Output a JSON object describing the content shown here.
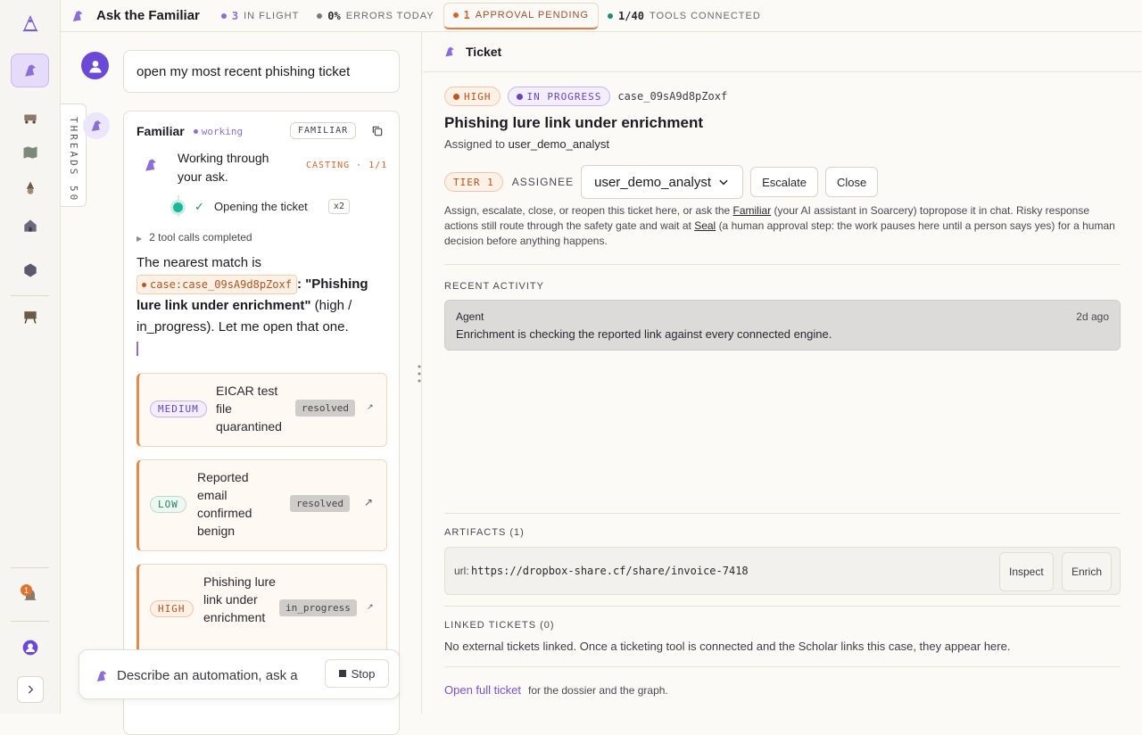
{
  "app": {
    "title": "Ask the Familiar"
  },
  "topbar": {
    "stats": [
      {
        "num": "3",
        "label": "IN FLIGHT",
        "color": "#8b6ed8"
      },
      {
        "num": "0%",
        "label": "ERRORS TODAY",
        "color": "#7a7880"
      },
      {
        "num": "1",
        "label": "APPROVAL PENDING",
        "color": "#d0672e"
      },
      {
        "num": "1/40",
        "label": "TOOLS CONNECTED",
        "color": "#1f8a76"
      }
    ]
  },
  "rail": {
    "notification_count": "1"
  },
  "chat": {
    "threads_label": "THREADS 50",
    "user_message": "open my most recent phishing ticket",
    "familiar": {
      "name": "Familiar",
      "status": "working",
      "badge": "FAMILIAR",
      "working_text": "Working through your ask.",
      "casting": "CASTING · 1/1",
      "step_label": "Opening the ticket",
      "step_count": "x2",
      "tool_calls": "2 tool calls completed",
      "answer_pre": "The nearest match is",
      "case_chip": "case:case_09sA9d8pZoxf",
      "answer_title": ": \"Phishing lure link under enrichment\"",
      "answer_post": " (high / in_progress). Let me open that one."
    },
    "tickets": [
      {
        "severity": "MEDIUM",
        "title": "EICAR test file quarantined",
        "status": "resolved",
        "arrow": "↗"
      },
      {
        "severity": "LOW",
        "title": "Reported email confirmed benign",
        "status": "resolved",
        "arrow": "↗"
      },
      {
        "severity": "HIGH",
        "title": "Phishing lure link under enrichment",
        "status": "in_progress",
        "arrow": "↗"
      }
    ],
    "composer": {
      "placeholder": "Describe an automation, ask a",
      "stop_label": "Stop"
    }
  },
  "ticket": {
    "header": "Ticket",
    "severity": "HIGH",
    "state": "IN PROGRESS",
    "case_id": "case_09sA9d8pZoxf",
    "title": "Phishing lure link under enrichment",
    "assigned_prefix": "Assigned to",
    "assigned_to": "user_demo_analyst",
    "tier": "TIER 1",
    "assignee_label": "ASSIGNEE",
    "assignee_value": "user_demo_analyst",
    "escalate_label": "Escalate",
    "close_label": "Close",
    "help_1": "Assign, escalate, close, or reopen this ticket here, or ask the",
    "help_familiar": "Familiar",
    "help_2": "(your AI assistant in Soarcery) topropose it in chat. Risky response actions still route through the safety gate and wait at",
    "help_seal": "Seal",
    "help_3": "(a human approval step: the work pauses here until a person says yes) for a human decision before anything happens.",
    "recent_title": "RECENT ACTIVITY",
    "activity": {
      "who": "Agent",
      "when": "2d ago",
      "msg": "Enrichment is checking the reported link against every connected engine."
    },
    "artifacts_title": "ARTIFACTS (1)",
    "artifact": {
      "kind": "url:",
      "value": "https://dropbox-share.cf/share/invoice-7418",
      "inspect": "Inspect",
      "enrich": "Enrich"
    },
    "linked_title": "LINKED TICKETS (0)",
    "linked_msg": "No external tickets linked. Once a ticketing tool is connected and the Scholar links this case, they appear here.",
    "open_full": "Open full ticket",
    "open_full_suffix": "for the dossier and the graph."
  }
}
